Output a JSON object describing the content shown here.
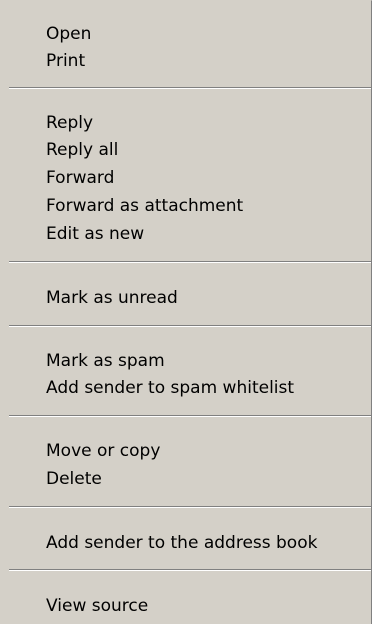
{
  "context_menu": {
    "items": [
      "Open",
      "Print",
      "Reply",
      "Reply all",
      "Forward",
      "Forward as attachment",
      "Edit as new",
      "Mark as unread",
      "Mark as spam",
      "Add sender to spam whitelist",
      "Move or copy",
      "Delete",
      "Add sender to the address book",
      "View source"
    ]
  }
}
